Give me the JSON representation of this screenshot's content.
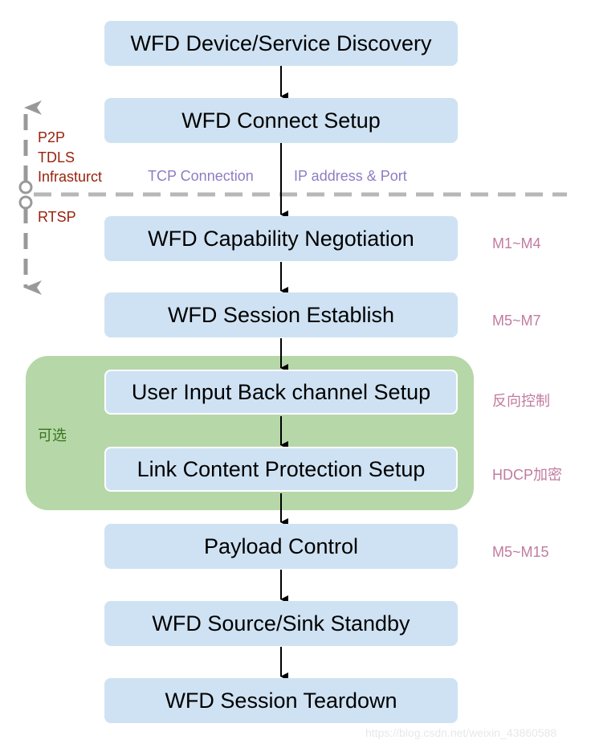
{
  "steps": [
    "WFD Device/Service Discovery",
    "WFD Connect Setup",
    "WFD Capability Negotiation",
    "WFD Session Establish",
    "User Input Back channel Setup",
    "Link Content Protection Setup",
    "Payload Control",
    "WFD Source/Sink Standby",
    "WFD Session Teardown"
  ],
  "left_labels": {
    "p2p": "P2P",
    "tdls": "TDLS",
    "infra": "Infrasturct",
    "rtsp": "RTSP"
  },
  "connection_labels": {
    "tcp": "TCP Connection",
    "ip": "IP address & Port"
  },
  "side_notes": [
    "M1~M4",
    "M5~M7",
    "反向控制",
    "HDCP加密",
    "M5~M15"
  ],
  "optional_group_label": "可选",
  "watermark": "https://blog.csdn.net/weixin_43860588",
  "colors": {
    "box": "#cfe2f3",
    "group": "#b6d7a8",
    "layer_text": "#99220e",
    "conn_text": "#8e7cc3",
    "note_text": "#c27ba0",
    "group_text": "#38761d",
    "divider": "#b7b7b7"
  }
}
